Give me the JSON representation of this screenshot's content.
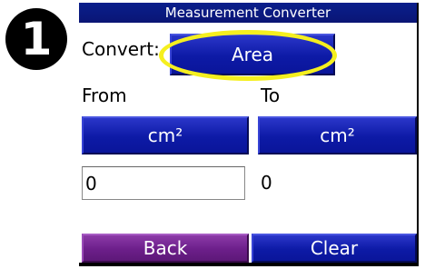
{
  "badge": {
    "number": "1"
  },
  "window": {
    "title": "Measurement Converter"
  },
  "convert": {
    "label": "Convert:",
    "value": "Area"
  },
  "from": {
    "label": "From",
    "unit": "cm²",
    "value": "0"
  },
  "to": {
    "label": "To",
    "unit": "cm²",
    "value": "0"
  },
  "footer": {
    "back_label": "Back",
    "clear_label": "Clear"
  },
  "colors": {
    "title_bar": "#0a1f8c",
    "button_blue": "#0d1aa6",
    "button_purple": "#6c1f8a",
    "highlight_ring": "#f5ef1f"
  }
}
